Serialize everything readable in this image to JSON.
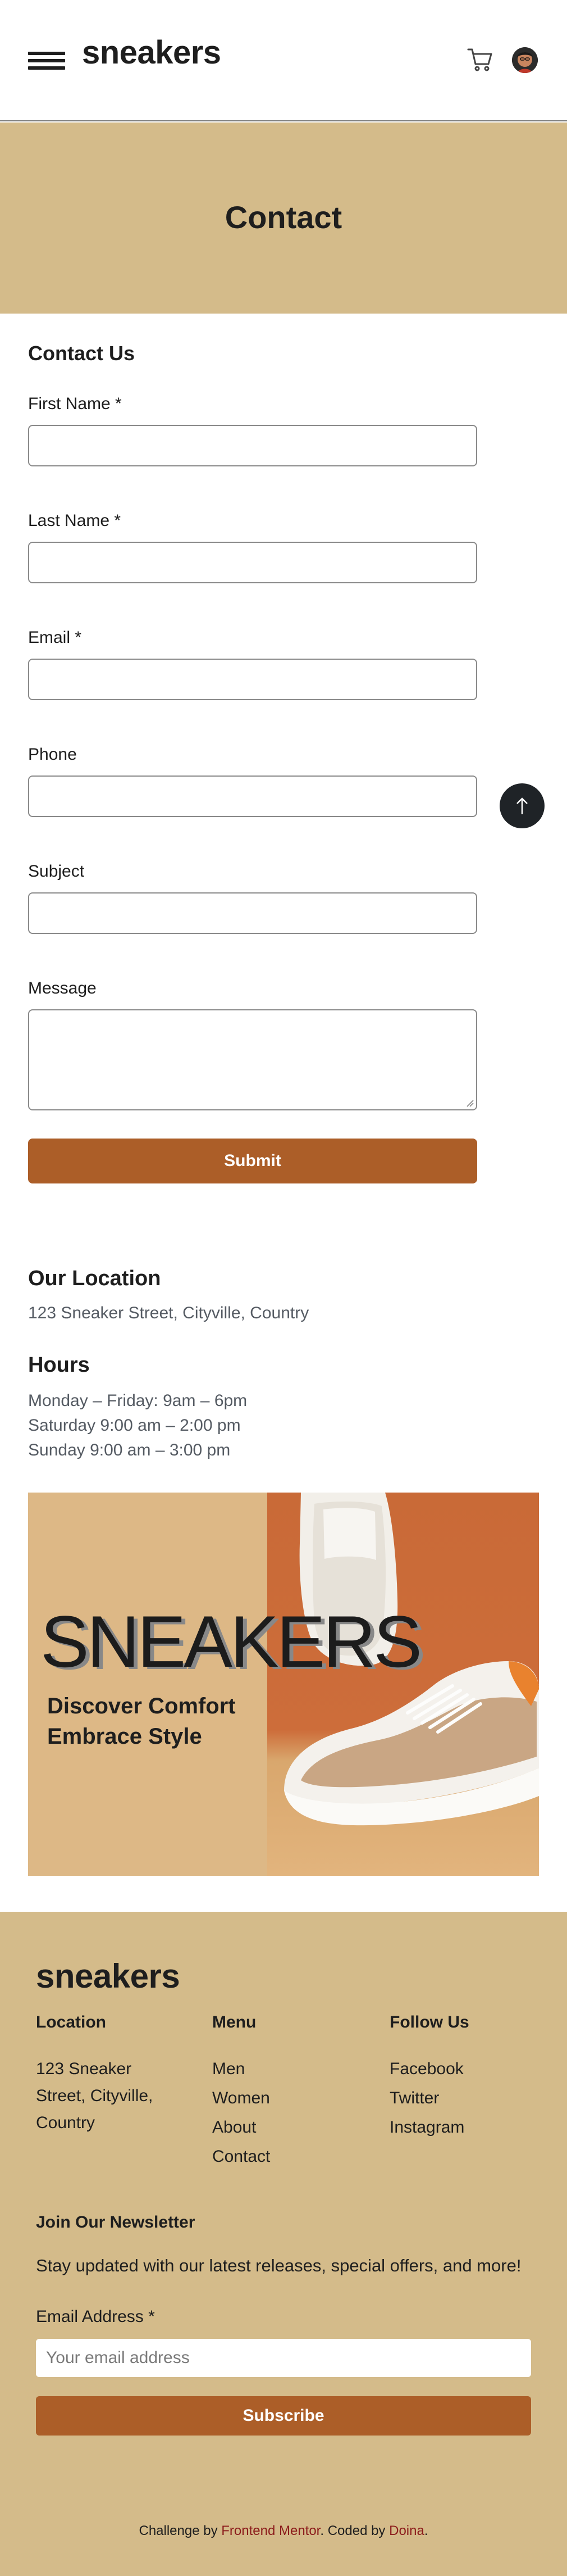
{
  "header": {
    "logo": "sneakers",
    "menu_icon": "hamburger-menu-icon",
    "cart_icon": "cart-icon",
    "avatar": "user-avatar"
  },
  "hero": {
    "title": "Contact"
  },
  "form": {
    "title": "Contact Us",
    "fields": [
      {
        "label": "First Name *",
        "value": ""
      },
      {
        "label": "Last Name *",
        "value": ""
      },
      {
        "label": "Email *",
        "value": ""
      },
      {
        "label": "Phone",
        "value": ""
      },
      {
        "label": "Subject",
        "value": ""
      },
      {
        "label": "Message",
        "value": ""
      }
    ],
    "submit_label": "Submit",
    "scroll_top_icon": "arrow-up-icon"
  },
  "location": {
    "title": "Our Location",
    "address": "123 Sneaker Street, Cityville, Country"
  },
  "hours": {
    "title": "Hours",
    "lines": [
      "Monday – Friday: 9am – 6pm",
      "Saturday 9:00 am – 2:00 pm",
      "Sunday 9:00 am – 3:00 pm"
    ]
  },
  "banner": {
    "headline": "SNEAKERS",
    "tagline_1": "Discover Comfort",
    "tagline_2": "Embrace Style"
  },
  "footer": {
    "logo": "sneakers",
    "location": {
      "title": "Location",
      "text": "123 Sneaker Street, Cityville, Country"
    },
    "menu": {
      "title": "Menu",
      "items": [
        "Men",
        "Women",
        "About",
        "Contact"
      ]
    },
    "follow": {
      "title": "Follow Us",
      "items": [
        "Facebook",
        "Twitter",
        "Instagram"
      ]
    },
    "newsletter": {
      "title": "Join Our Newsletter",
      "text": "Stay updated with our latest releases, special offers, and more!",
      "email_label": "Email Address *",
      "email_placeholder": "Your email address",
      "subscribe_label": "Subscribe"
    },
    "credit": {
      "prefix": "Challenge by ",
      "link1": "Frontend Mentor",
      "middle": ". Coded by ",
      "link2": "Doina",
      "suffix": "."
    }
  },
  "colors": {
    "accent": "#ac5e28",
    "band": "#d4bb8a",
    "dark": "#1e1e1e"
  }
}
